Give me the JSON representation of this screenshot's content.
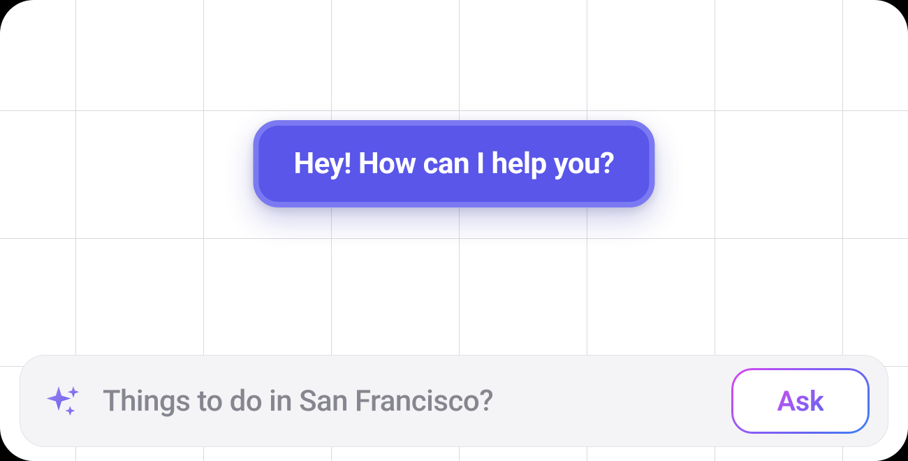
{
  "chat": {
    "greeting": "Hey! How can I help you?"
  },
  "input": {
    "placeholder": "Things to do in San Francisco?",
    "value": ""
  },
  "actions": {
    "ask_label": "Ask"
  },
  "icons": {
    "sparkle": "sparkle-icon"
  },
  "colors": {
    "bubble_bg": "#5956e9",
    "bubble_border": "#7b79f2",
    "input_bg": "#f4f4f6",
    "gradient_start": "#d946ef",
    "gradient_end": "#3b82f6"
  }
}
